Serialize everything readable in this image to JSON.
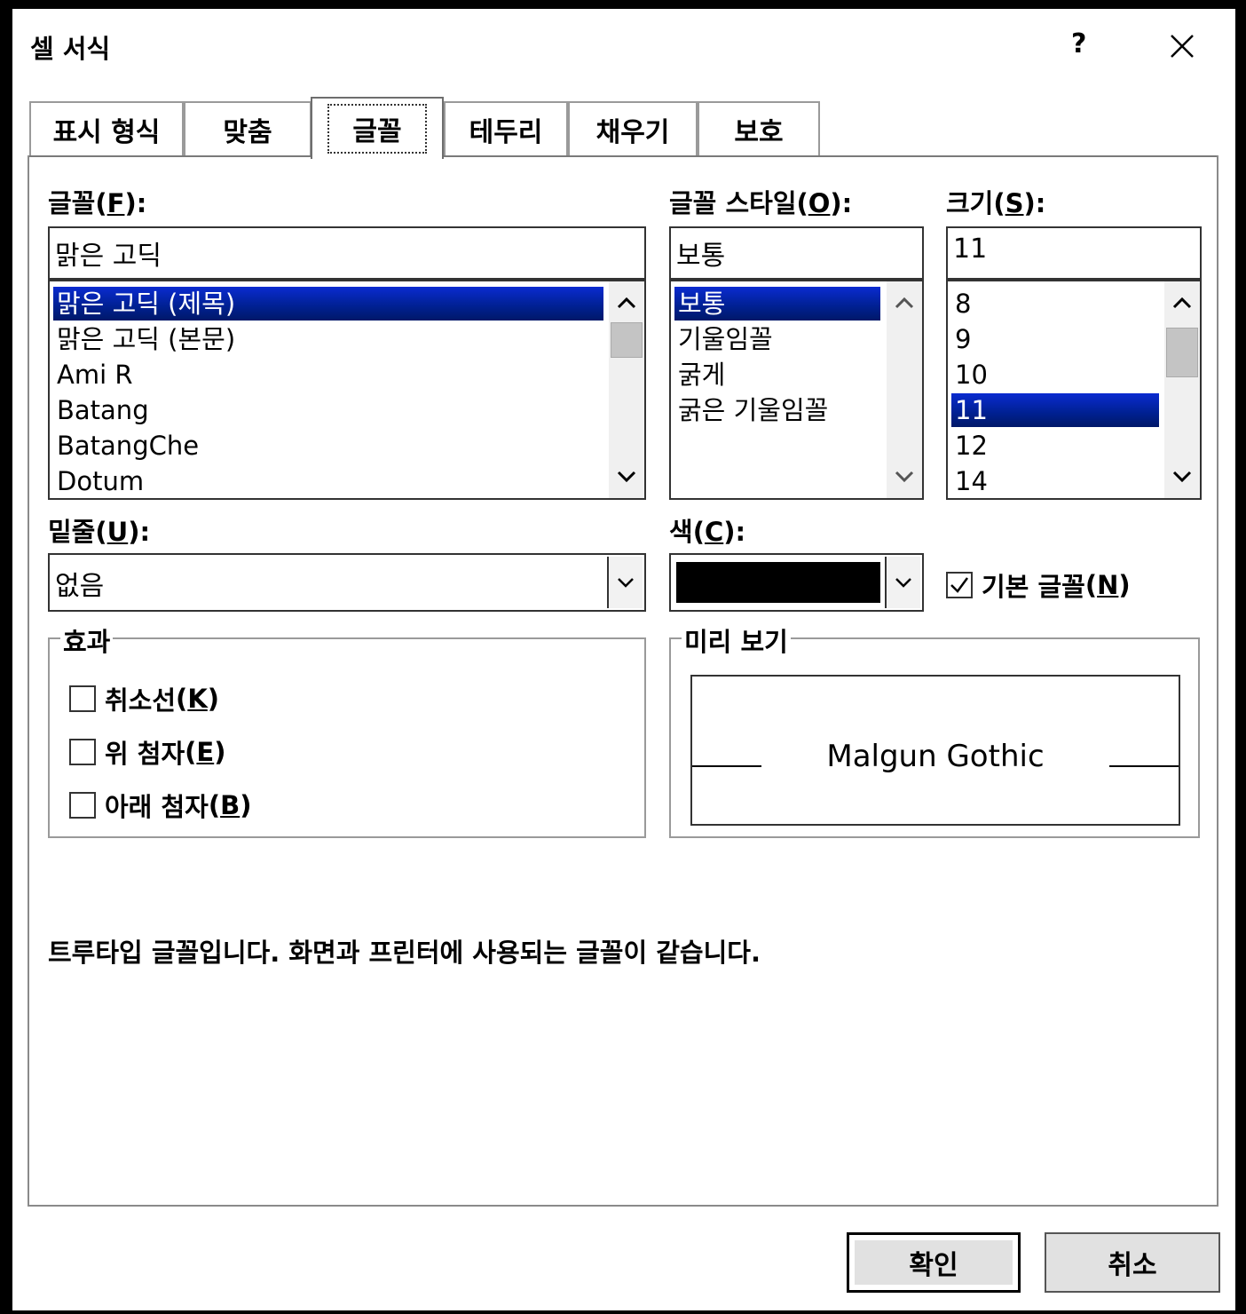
{
  "dialog": {
    "title": "셀 서식",
    "help_label": "?"
  },
  "tabs": [
    {
      "label": "표시 형식"
    },
    {
      "label": "맞춤"
    },
    {
      "label": "글꼴"
    },
    {
      "label": "테두리"
    },
    {
      "label": "채우기"
    },
    {
      "label": "보호"
    }
  ],
  "font": {
    "label": "글꼴",
    "key": "F",
    "value": "맑은 고딕",
    "list": [
      "맑은 고딕 (제목)",
      "맑은 고딕 (본문)",
      "Ami R",
      "Batang",
      "BatangChe",
      "Dotum"
    ],
    "selected_index": 0
  },
  "style": {
    "label": "글꼴 스타일",
    "key": "O",
    "value": "보통",
    "list": [
      "보통",
      "기울임꼴",
      "굵게",
      "굵은 기울임꼴"
    ],
    "selected_index": 0
  },
  "size": {
    "label": "크기",
    "key": "S",
    "value": "11",
    "list": [
      "8",
      "9",
      "10",
      "11",
      "12",
      "14"
    ],
    "selected_index": 3
  },
  "underline": {
    "label": "밑줄",
    "key": "U",
    "value": "없음"
  },
  "color": {
    "label": "색",
    "key": "C",
    "value_hex": "#000000"
  },
  "normal_font": {
    "label": "기본 글꼴",
    "key": "N",
    "checked": true
  },
  "effects": {
    "title": "효과",
    "strike": {
      "label": "취소선",
      "key": "K",
      "checked": false
    },
    "superscript": {
      "label": "위 첨자",
      "key": "E",
      "checked": false
    },
    "subscript": {
      "label": "아래 첨자",
      "key": "B",
      "checked": false
    }
  },
  "preview": {
    "title": "미리 보기",
    "text": "Malgun Gothic"
  },
  "description": "트루타입 글꼴입니다. 화면과 프린터에 사용되는 글꼴이 같습니다.",
  "buttons": {
    "ok": "확인",
    "cancel": "취소"
  },
  "colors": {
    "selection": "#0a2bd0",
    "button_face": "#e1e1e1"
  }
}
